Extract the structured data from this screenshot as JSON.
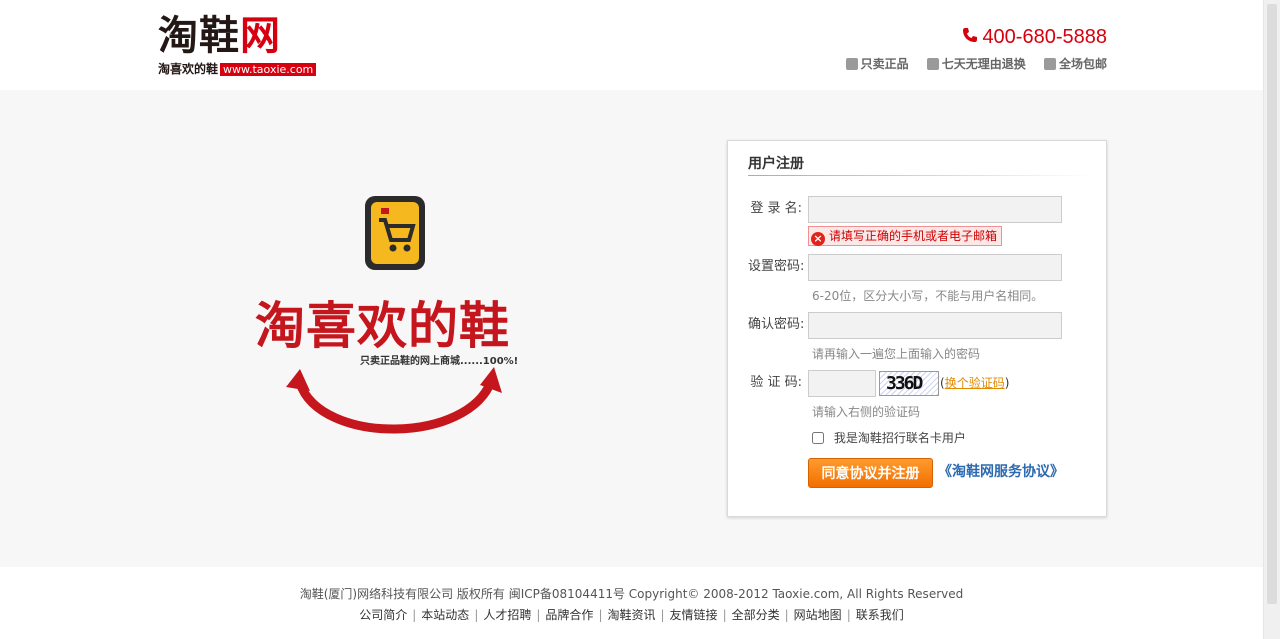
{
  "header": {
    "logo_mark_a": "淘鞋",
    "logo_mark_b": "网",
    "logo_slogan": "淘喜欢的鞋",
    "logo_url": "www.taoxie.com",
    "hotline": "400-680-5888",
    "promises": [
      {
        "icon": "genuine-icon",
        "label": "只卖正品"
      },
      {
        "icon": "return-icon",
        "label": "七天无理由退换"
      },
      {
        "icon": "truck-icon",
        "label": "全场包邮"
      }
    ]
  },
  "promo": {
    "slogan": "淘喜欢的鞋",
    "tagline": "只卖正品鞋的网上商城......100%!"
  },
  "register": {
    "title": "用户注册",
    "username": {
      "label": "登 录 名:",
      "value": "",
      "error": "请填写正确的手机或者电子邮箱"
    },
    "password": {
      "label": "设置密码:",
      "value": "",
      "hint": "6-20位，区分大小写，不能与用户名相同。"
    },
    "confirm": {
      "label": "确认密码:",
      "value": "",
      "hint": "请再输入一遍您上面输入的密码"
    },
    "captcha": {
      "label": "验 证 码:",
      "value": "",
      "image_text": "336D",
      "change_prefix": "(",
      "change_link": "换个验证码",
      "change_suffix": ")",
      "hint": "请输入右侧的验证码"
    },
    "member_card": {
      "label": "我是淘鞋招行联名卡用户",
      "checked": false
    },
    "submit_label": "同意协议并注册",
    "agreement_link": "《淘鞋网服务协议》"
  },
  "footer": {
    "copyright": "淘鞋(厦门)网络科技有限公司 版权所有 闽ICP备08104411号 Copyright© 2008-2012 Taoxie.com, All Rights Reserved",
    "links": [
      "公司简介",
      "本站动态",
      "人才招聘",
      "品牌合作",
      "淘鞋资讯",
      "友情链接",
      "全部分类",
      "网站地图",
      "联系我们"
    ]
  },
  "colors": {
    "brand_red": "#d7000f",
    "accent_orange": "#f26f00",
    "link_blue": "#2d6ab0",
    "band_bg": "#f7f7f7"
  }
}
